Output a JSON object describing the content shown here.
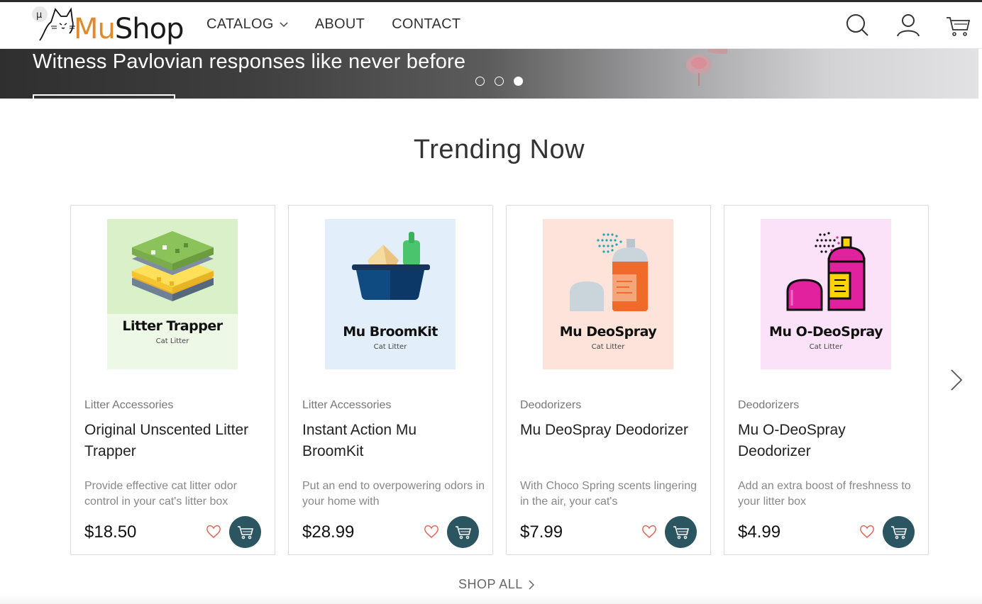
{
  "header": {
    "logo": {
      "mu": "Mu",
      "shop": "Shop",
      "badge": "µ"
    },
    "nav": [
      {
        "label": "CATALOG",
        "has_dropdown": true
      },
      {
        "label": "ABOUT"
      },
      {
        "label": "CONTACT"
      }
    ],
    "icons": [
      "search-icon",
      "account-icon",
      "cart-icon"
    ]
  },
  "hero": {
    "title": "Witness Pavlovian responses like never before",
    "slides": 3,
    "active_slide": 3
  },
  "trending": {
    "title": "Trending Now",
    "products": [
      {
        "image_title": "Litter Trapper",
        "image_subtitle": "Cat Litter",
        "image_bg": "#d9f0c8",
        "category": "Litter Accessories",
        "name": "Original Unscented Litter Trapper",
        "description": "Provide effective cat litter odor control in your cat's litter box",
        "price": "$18.50"
      },
      {
        "image_title": "Mu BroomKit",
        "image_subtitle": "Cat Litter",
        "image_bg": "#e2eefa",
        "category": "Litter Accessories",
        "name": "Instant Action Mu BroomKit",
        "description": "Put an end to overpowering odors in your home with",
        "price": "$28.99"
      },
      {
        "image_title": "Mu DeoSpray",
        "image_subtitle": "Cat Litter",
        "image_bg": "#fde3da",
        "category": "Deodorizers",
        "name": "Mu DeoSpray Deodorizer",
        "description": "With Choco Spring scents lingering in the air, your cat's",
        "price": "$7.99"
      },
      {
        "image_title": "Mu O-DeoSpray",
        "image_subtitle": "Cat Litter",
        "image_bg": "#fbe2f8",
        "category": "Deodorizers",
        "name": "Mu O-DeoSpray Deodorizer",
        "description": "Add an extra boost of freshness to your litter box",
        "price": "$4.99"
      }
    ],
    "shop_all": "SHOP ALL"
  },
  "colors": {
    "logo_mu": "#e08a2c",
    "cart_button": "#2b5560",
    "heart": "#e06a5a"
  }
}
